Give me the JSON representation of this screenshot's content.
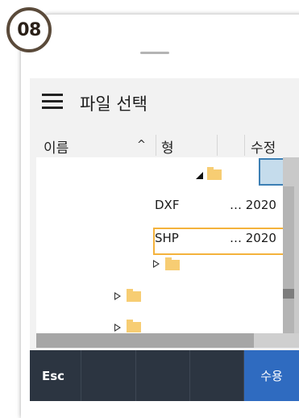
{
  "step_badge": "08",
  "header": {
    "title": "파일 선택"
  },
  "columns": {
    "name": "이름",
    "type": "형",
    "modified": "수정"
  },
  "rows": [
    {
      "type_text": "DXF",
      "date": "… 2020"
    },
    {
      "type_text": "SHP",
      "date": "… 2020"
    }
  ],
  "toolbar": {
    "esc_label": "Esc",
    "accept_label": "수용"
  },
  "colors": {
    "accent": "#2f6bc0",
    "highlight": "#f4b23c",
    "selection": "#c5dcec",
    "folder": "#f7cd73"
  }
}
